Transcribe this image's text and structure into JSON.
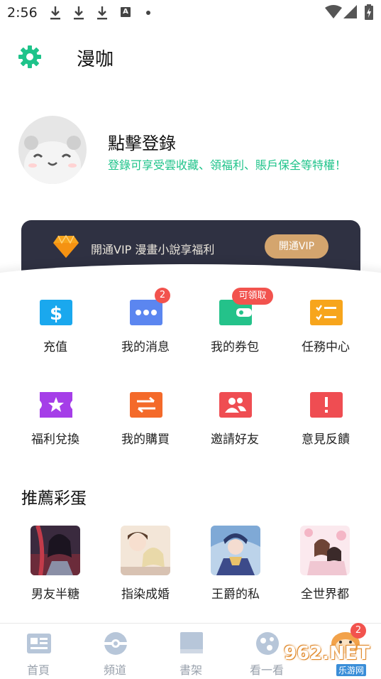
{
  "status_bar": {
    "time": "2:56",
    "notif_letter": "A"
  },
  "header": {
    "title": "漫咖"
  },
  "profile": {
    "name": "點擊登錄",
    "subtitle": "登錄可享受雲收藏、領福利、賬戶保全等特權！"
  },
  "vip": {
    "text": "開通VIP 漫畫小說享福利",
    "button": "開通VIP"
  },
  "grid": [
    {
      "label": "充值",
      "icon": "dollar-icon",
      "color": "#1aa8ee"
    },
    {
      "label": "我的消息",
      "icon": "message-icon",
      "color": "#5b86f0",
      "badge": "2"
    },
    {
      "label": "我的券包",
      "icon": "wallet-icon",
      "color": "#24c28a",
      "badge": "可領取"
    },
    {
      "label": "任務中心",
      "icon": "task-icon",
      "color": "#f7a51c"
    },
    {
      "label": "福利兌換",
      "icon": "star-ticket-icon",
      "color": "#a53ee8"
    },
    {
      "label": "我的購買",
      "icon": "transfer-icon",
      "color": "#f46a2a"
    },
    {
      "label": "邀請好友",
      "icon": "invite-icon",
      "color": "#ef4d52"
    },
    {
      "label": "意見反饋",
      "icon": "feedback-icon",
      "color": "#ef4d52"
    }
  ],
  "recommend": {
    "title": "推薦彩蛋",
    "items": [
      {
        "label": "男友半糖"
      },
      {
        "label": "指染成婚"
      },
      {
        "label": "王爵的私"
      },
      {
        "label": "全世界都"
      }
    ]
  },
  "bottom_nav": {
    "items": [
      {
        "label": "首頁",
        "icon": "home-icon"
      },
      {
        "label": "頻道",
        "icon": "channel-icon"
      },
      {
        "label": "書架",
        "icon": "bookshelf-icon"
      },
      {
        "label": "看一看",
        "icon": "look-icon"
      }
    ],
    "badge": "2"
  },
  "watermark": {
    "main": "962.NET",
    "sub": "乐游网"
  },
  "colors": {
    "accent_green": "#1ec38a",
    "badge_red": "#f2534e",
    "vip_bg": "#2f3142",
    "vip_gold": "#d4a56e"
  }
}
